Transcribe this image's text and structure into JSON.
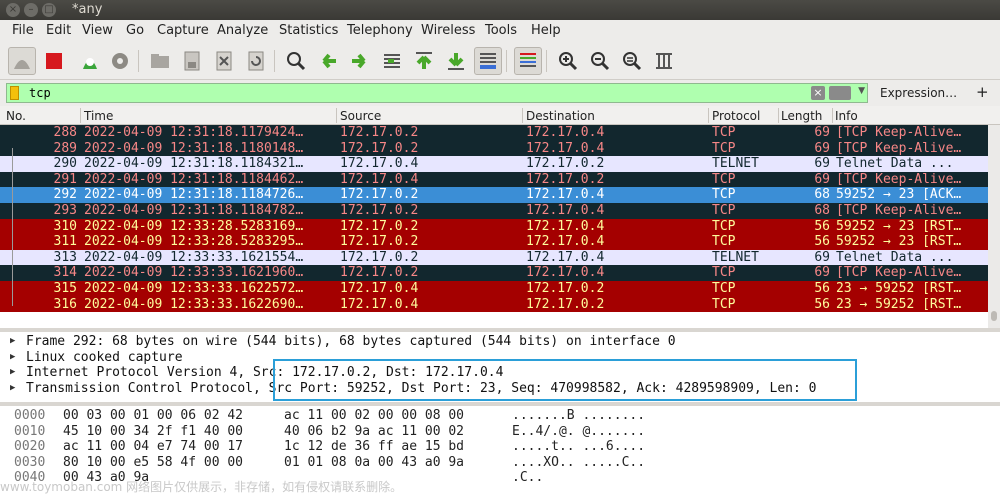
{
  "window": {
    "title": "*any"
  },
  "menu": [
    "File",
    "Edit",
    "View",
    "Go",
    "Capture",
    "Analyze",
    "Statistics",
    "Telephony",
    "Wireless",
    "Tools",
    "Help"
  ],
  "toolbar_icons": [
    "shark-fin-icon",
    "stop-icon",
    "restart-icon",
    "options-gear-icon",
    "open-folder-icon",
    "save-file-icon",
    "close-file-icon",
    "reload-icon",
    "find-icon",
    "back-arrow-icon",
    "forward-arrow-icon",
    "go-to-packet-icon",
    "first-packet-icon",
    "last-packet-icon",
    "autoscroll-icon",
    "colorize-icon",
    "zoom-in-icon",
    "zoom-out-icon",
    "zoom-normal-icon",
    "resize-columns-icon"
  ],
  "filter": {
    "value": "tcp",
    "expression_label": "Expression…",
    "add_label": "+"
  },
  "columns": [
    "No.",
    "Time",
    "Source",
    "Destination",
    "Protocol",
    "Length",
    "Info"
  ],
  "packets": [
    {
      "no": "288",
      "time": "2022-04-09 12:31:18.1179424…",
      "src": "172.17.0.2",
      "dst": "172.17.0.4",
      "proto": "TCP",
      "len": "69",
      "info": "[TCP Keep-Alive…",
      "bg": "#12272e",
      "fg": "#f78787"
    },
    {
      "no": "289",
      "time": "2022-04-09 12:31:18.1180148…",
      "src": "172.17.0.2",
      "dst": "172.17.0.4",
      "proto": "TCP",
      "len": "69",
      "info": "[TCP Keep-Alive…",
      "bg": "#12272e",
      "fg": "#f78787"
    },
    {
      "no": "290",
      "time": "2022-04-09 12:31:18.1184321…",
      "src": "172.17.0.4",
      "dst": "172.17.0.2",
      "proto": "TELNET",
      "len": "69",
      "info": "Telnet Data ...",
      "bg": "#e7e6ff",
      "fg": "#12272e"
    },
    {
      "no": "291",
      "time": "2022-04-09 12:31:18.1184462…",
      "src": "172.17.0.4",
      "dst": "172.17.0.2",
      "proto": "TCP",
      "len": "69",
      "info": "[TCP Keep-Alive…",
      "bg": "#12272e",
      "fg": "#f78787"
    },
    {
      "no": "292",
      "time": "2022-04-09 12:31:18.1184726…",
      "src": "172.17.0.2",
      "dst": "172.17.0.4",
      "proto": "TCP",
      "len": "68",
      "info": "59252 → 23 [ACK…",
      "bg": "#3b8ed6",
      "fg": "#ffffff"
    },
    {
      "no": "293",
      "time": "2022-04-09 12:31:18.1184782…",
      "src": "172.17.0.2",
      "dst": "172.17.0.4",
      "proto": "TCP",
      "len": "68",
      "info": "[TCP Keep-Alive…",
      "bg": "#12272e",
      "fg": "#f78787"
    },
    {
      "no": "310",
      "time": "2022-04-09 12:33:28.5283169…",
      "src": "172.17.0.2",
      "dst": "172.17.0.4",
      "proto": "TCP",
      "len": "56",
      "info": "59252 → 23 [RST…",
      "bg": "#a40000",
      "fg": "#fffc9c"
    },
    {
      "no": "311",
      "time": "2022-04-09 12:33:28.5283295…",
      "src": "172.17.0.2",
      "dst": "172.17.0.4",
      "proto": "TCP",
      "len": "56",
      "info": "59252 → 23 [RST…",
      "bg": "#a40000",
      "fg": "#fffc9c"
    },
    {
      "no": "313",
      "time": "2022-04-09 12:33:33.1621554…",
      "src": "172.17.0.2",
      "dst": "172.17.0.4",
      "proto": "TELNET",
      "len": "69",
      "info": "Telnet Data ...",
      "bg": "#e7e6ff",
      "fg": "#12272e"
    },
    {
      "no": "314",
      "time": "2022-04-09 12:33:33.1621960…",
      "src": "172.17.0.2",
      "dst": "172.17.0.4",
      "proto": "TCP",
      "len": "69",
      "info": "[TCP Keep-Alive…",
      "bg": "#12272e",
      "fg": "#f78787"
    },
    {
      "no": "315",
      "time": "2022-04-09 12:33:33.1622572…",
      "src": "172.17.0.4",
      "dst": "172.17.0.2",
      "proto": "TCP",
      "len": "56",
      "info": "23 → 59252 [RST…",
      "bg": "#a40000",
      "fg": "#fffc9c"
    },
    {
      "no": "316",
      "time": "2022-04-09 12:33:33.1622690…",
      "src": "172.17.0.4",
      "dst": "172.17.0.2",
      "proto": "TCP",
      "len": "56",
      "info": "23 → 59252 [RST…",
      "bg": "#a40000",
      "fg": "#fffc9c"
    }
  ],
  "details": [
    "Frame 292: 68 bytes on wire (544 bits), 68 bytes captured (544 bits) on interface 0",
    "Linux cooked capture",
    "Internet Protocol Version 4, Src: 172.17.0.2, Dst: 172.17.0.4",
    "Transmission Control Protocol, Src Port: 59252, Dst Port: 23, Seq: 470998582, Ack: 4289598909, Len: 0"
  ],
  "bytes": [
    {
      "off": "0000",
      "h1": "00 03 00 01 00 06 02 42",
      "h2": "ac 11 00 02 00 00 08 00",
      "asc": ".......B ........"
    },
    {
      "off": "0010",
      "h1": "45 10 00 34 2f f1 40 00",
      "h2": "40 06 b2 9a ac 11 00 02",
      "asc": "E..4/.@. @......."
    },
    {
      "off": "0020",
      "h1": "ac 11 00 04 e7 74 00 17",
      "h2": "1c 12 de 36 ff ae 15 bd",
      "asc": ".....t.. ...6...."
    },
    {
      "off": "0030",
      "h1": "80 10 00 e5 58 4f 00 00",
      "h2": "01 01 08 0a 00 43 a0 9a",
      "asc": "....XO.. .....C.."
    },
    {
      "off": "0040",
      "h1": "00 43 a0 9a",
      "h2": "",
      "asc": ".C.."
    }
  ],
  "watermark": "www.toymoban.com 网络图片仅供展示，非存储，如有侵权请联系删除。"
}
